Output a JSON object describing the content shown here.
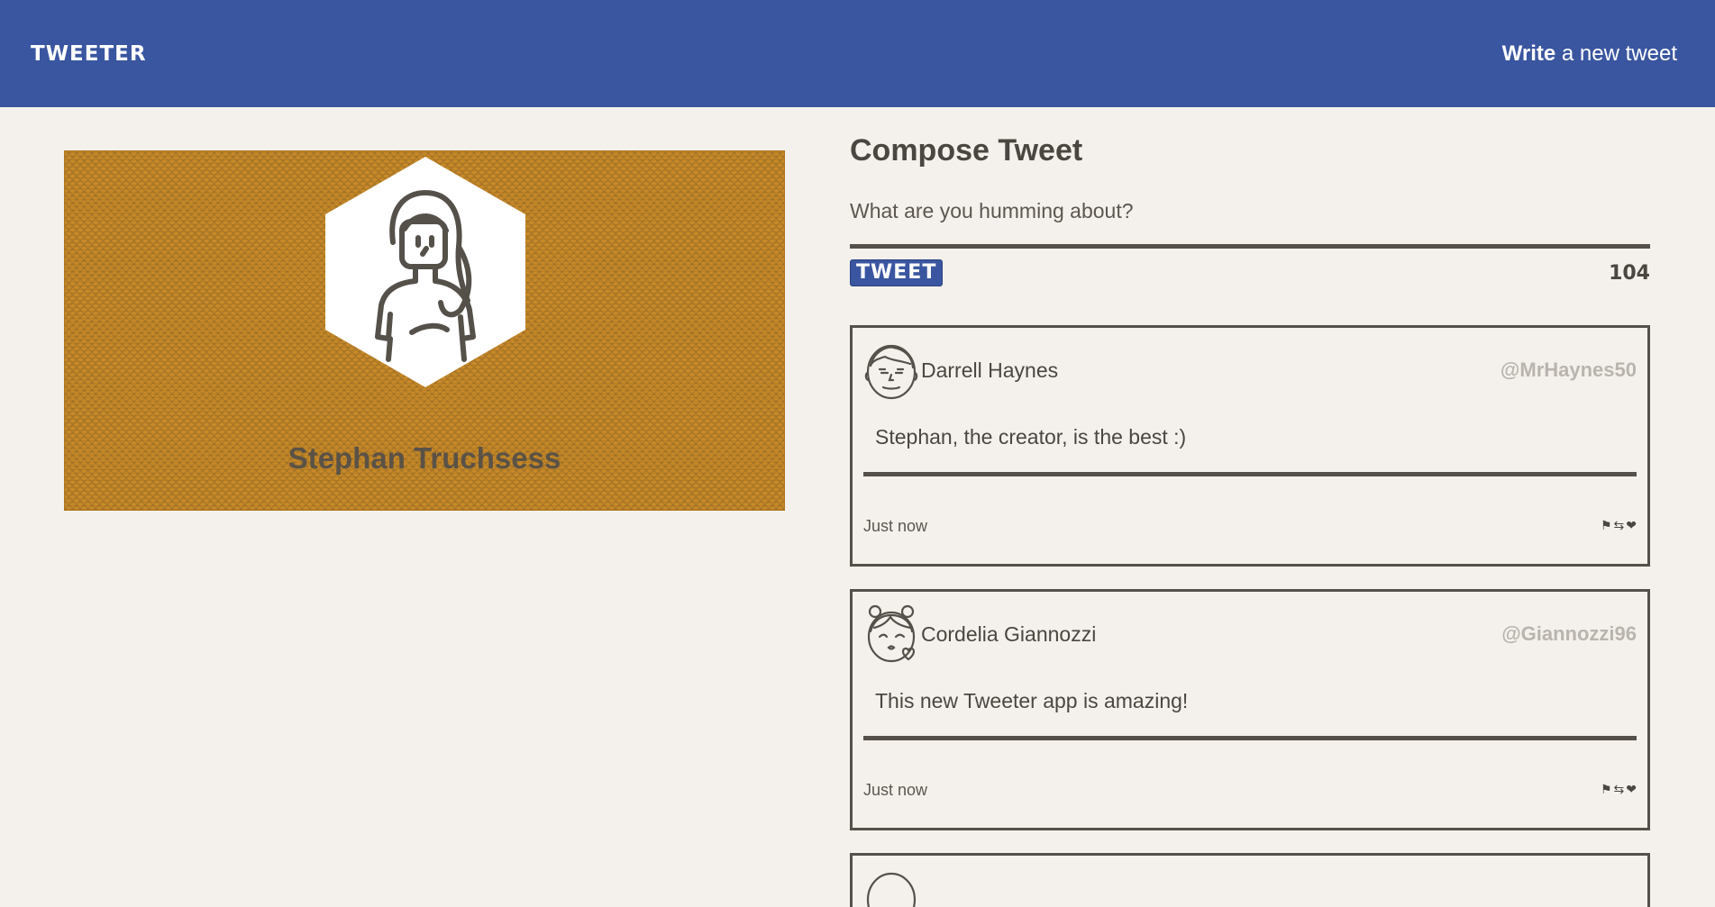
{
  "nav": {
    "brand": "TWEETER",
    "write_bold": "Write",
    "write_rest": " a new tweet"
  },
  "profile": {
    "name": "Stephan Truchsess",
    "banner_color": "#c98a28",
    "avatar_icon": "woman-avatar-icon"
  },
  "compose": {
    "title": "Compose Tweet",
    "placeholder": "What are you humming about?",
    "button_label": "TWEET",
    "counter": "104"
  },
  "tweets": [
    {
      "name": "Darrell Haynes",
      "handle": "@MrHaynes50",
      "text": "Stephan, the creator, is the best :)",
      "time": "Just now",
      "avatar_icon": "man-avatar-icon"
    },
    {
      "name": "Cordelia Giannozzi",
      "handle": "@Giannozzi96",
      "text": "This new Tweeter app is amazing!",
      "time": "Just now",
      "avatar_icon": "girl-avatar-icon"
    }
  ],
  "actions": {
    "flag": "⚑",
    "retweet": "⇆",
    "like": "❤"
  },
  "colors": {
    "nav": "#3a56a0",
    "background": "#f4f1ec",
    "text": "#4a4640",
    "handle": "#b9b4ad"
  }
}
